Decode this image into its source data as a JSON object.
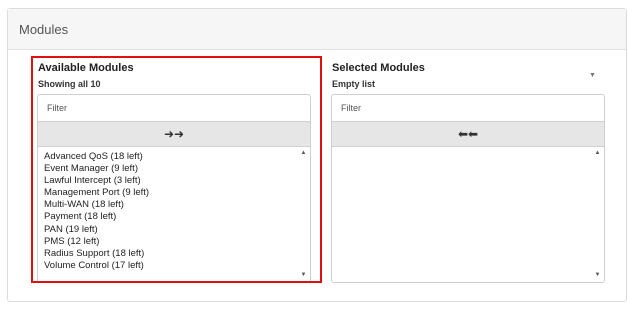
{
  "panel": {
    "title": "Modules"
  },
  "available": {
    "title": "Available Modules",
    "subtitle": "Showing all 10",
    "filter_placeholder": "Filter",
    "move_all_icon": "double-right-arrow-icon",
    "move_all_glyph": "➜➜",
    "items": [
      "Advanced QoS (18 left)",
      "Event Manager (9 left)",
      "Lawful Intercept (3 left)",
      "Management Port (9 left)",
      "Multi-WAN (18 left)",
      "Payment (18 left)",
      "PAN (19 left)",
      "PMS (12 left)",
      "Radius Support (18 left)",
      "Volume Control (17 left)"
    ]
  },
  "selected": {
    "title": "Selected Modules",
    "subtitle": "Empty list",
    "filter_placeholder": "Filter",
    "remove_all_icon": "double-left-arrow-icon",
    "remove_all_glyph": "⬅⬅",
    "items": []
  },
  "colors": {
    "highlight": "#e01010",
    "header_bg": "#f6f6f6",
    "button_bg": "#e6e6e6"
  }
}
